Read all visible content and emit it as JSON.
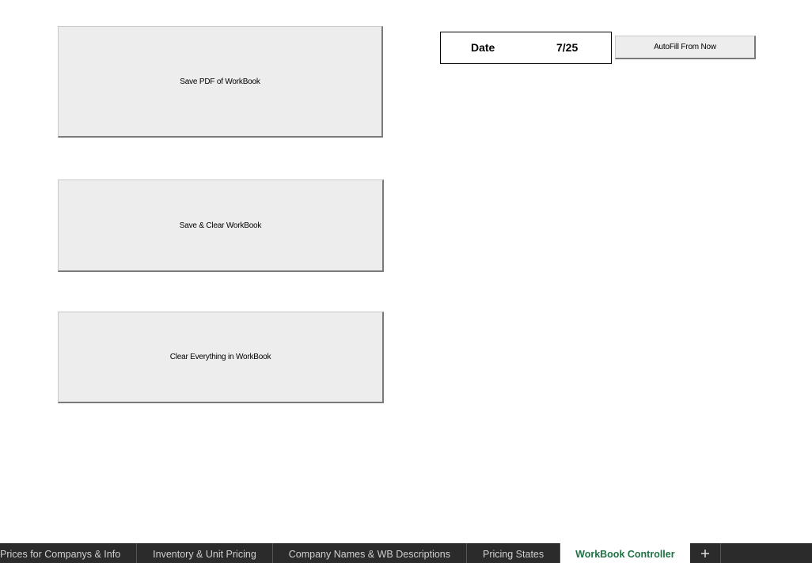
{
  "sheet": {
    "buttons": {
      "save_pdf": "Save PDF of WorkBook",
      "save_clear": "Save & Clear WorkBook",
      "clear_all": "Clear Everything in WorkBook",
      "autofill": "AutoFill From Now"
    },
    "date_cell": {
      "label": "Date",
      "value": "7/25"
    }
  },
  "tabs": [
    {
      "label": "Prices for Companys & Info",
      "active": false
    },
    {
      "label": "Inventory & Unit Pricing",
      "active": false
    },
    {
      "label": "Company Names & WB Descriptions",
      "active": false
    },
    {
      "label": "Pricing States",
      "active": false
    },
    {
      "label": "WorkBook Controller",
      "active": true
    }
  ],
  "add_sheet_icon": "plus-icon",
  "colors": {
    "active_tab_text": "#1e7145",
    "tab_bar_bg": "#2b2b2b",
    "button_face": "#ededed"
  }
}
